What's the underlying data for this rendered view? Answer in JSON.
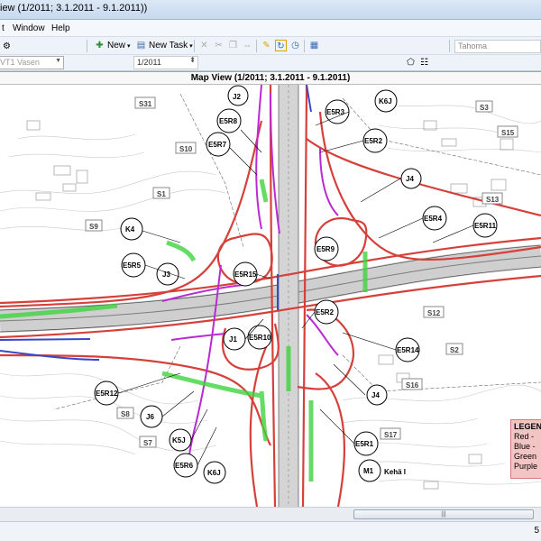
{
  "window": {
    "title": "iew (1/2011; 3.1.2011 - 9.1.2011))"
  },
  "menu": {
    "items": [
      "t",
      "Window",
      "Help"
    ]
  },
  "toolbar": {
    "new_label": "New",
    "new_task_label": "New Task",
    "font_value": "Tahoma"
  },
  "toolbar2": {
    "layer_value": "VT1 Vasen",
    "period_value": "1/2011"
  },
  "map": {
    "title": "Map View (1/2011; 3.1.2011 - 9.1.2011)",
    "section_labels": [
      "J2",
      "S31",
      "E5R8",
      "S10",
      "E5R7",
      "S1",
      "S9",
      "K4",
      "E5R5",
      "J3",
      "E5R15",
      "J1",
      "E5R10",
      "E5R12",
      "S8",
      "J6",
      "S7",
      "K5J",
      "E5R6",
      "K6J",
      "E5R3",
      "E5R2",
      "J4",
      "S3",
      "S15",
      "E5R4",
      "E5R11",
      "S13",
      "E5R9",
      "K6J",
      "S12",
      "E5R2",
      "E5R14",
      "S2",
      "S16",
      "J4",
      "S17",
      "E5R1",
      "M1",
      "Kehä I"
    ],
    "colors": {
      "red": "#d6403a",
      "blue": "#3a48c8",
      "green": "#3fd43f",
      "purple": "#b92bd1",
      "road": "#8b8b8b"
    }
  },
  "legend": {
    "title": "LEGEN",
    "items": [
      "Red -",
      "Blue -",
      "Green",
      "Purple"
    ]
  },
  "scrollbar": {
    "grip": "|||"
  },
  "status": {
    "right_text": "5"
  }
}
